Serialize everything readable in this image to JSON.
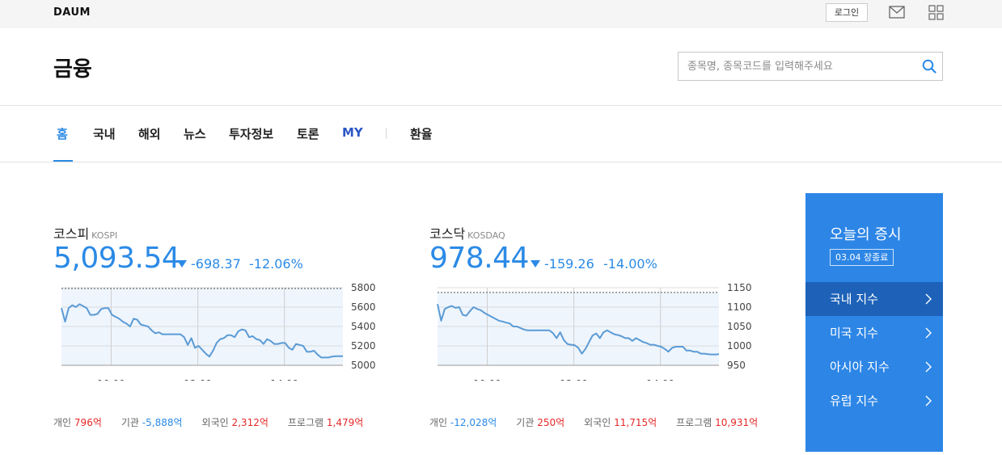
{
  "topbar": {
    "logo": "DAUM",
    "login_label": "로그인"
  },
  "header": {
    "title": "금융",
    "search_placeholder": "종목명, 종목코드를 입력해주세요"
  },
  "nav": {
    "items": [
      {
        "label": "홈"
      },
      {
        "label": "국내"
      },
      {
        "label": "해외"
      },
      {
        "label": "뉴스"
      },
      {
        "label": "투자정보"
      },
      {
        "label": "토론"
      },
      {
        "label": "MY"
      },
      {
        "label": "환율"
      }
    ],
    "active_index": 0
  },
  "markets": [
    {
      "name": "코스피",
      "name_en": "KOSPI",
      "value": "5,093.54",
      "change": "-698.37",
      "change_pct": "-12.06%",
      "trades": [
        {
          "label": "개인",
          "value": "796억",
          "dir": "up"
        },
        {
          "label": "기관",
          "value": "-5,888억",
          "dir": "down"
        },
        {
          "label": "외국인",
          "value": "2,312억",
          "dir": "up"
        },
        {
          "label": "프로그램",
          "value": "1,479억",
          "dir": "up"
        }
      ]
    },
    {
      "name": "코스닥",
      "name_en": "KOSDAQ",
      "value": "978.44",
      "change": "-159.26",
      "change_pct": "-14.00%",
      "trades": [
        {
          "label": "개인",
          "value": "-12,028억",
          "dir": "down"
        },
        {
          "label": "기관",
          "value": "250억",
          "dir": "up"
        },
        {
          "label": "외국인",
          "value": "11,715억",
          "dir": "up"
        },
        {
          "label": "프로그램",
          "value": "10,931억",
          "dir": "up"
        }
      ]
    }
  ],
  "chart_data": [
    {
      "type": "area",
      "x_ticks": [
        "10:00",
        "12:00",
        "14:00"
      ],
      "y_ticks": [
        5800,
        5600,
        5400,
        5200,
        5000
      ],
      "ylim": [
        5000,
        5800
      ],
      "prev_close": 5791.91,
      "x": [
        "09:00",
        "09:05",
        "09:10",
        "09:15",
        "09:20",
        "09:25",
        "09:30",
        "09:35",
        "09:40",
        "09:45",
        "09:50",
        "09:55",
        "10:00",
        "10:05",
        "10:10",
        "10:15",
        "10:20",
        "10:25",
        "10:30",
        "10:35",
        "10:40",
        "10:45",
        "10:50",
        "10:55",
        "11:00",
        "11:05",
        "11:10",
        "11:15",
        "11:20",
        "11:25",
        "11:30",
        "11:35",
        "11:40",
        "11:45",
        "11:50",
        "11:55",
        "12:00",
        "12:05",
        "12:10",
        "12:15",
        "12:20",
        "12:25",
        "12:30",
        "12:35",
        "12:40",
        "12:45",
        "12:50",
        "12:55",
        "13:00",
        "13:05",
        "13:10",
        "13:15",
        "13:20",
        "13:25",
        "13:30",
        "13:35",
        "13:40",
        "13:45",
        "13:50",
        "13:55",
        "14:00",
        "14:05",
        "14:10",
        "14:15",
        "14:20",
        "14:25",
        "14:30",
        "14:35",
        "14:40",
        "14:45",
        "14:50",
        "14:55",
        "15:00",
        "15:05",
        "15:10",
        "15:15",
        "15:20",
        "15:25",
        "15:30"
      ],
      "values": [
        5590,
        5450,
        5590,
        5620,
        5600,
        5630,
        5610,
        5590,
        5520,
        5520,
        5530,
        5580,
        5590,
        5590,
        5520,
        5500,
        5480,
        5450,
        5430,
        5400,
        5480,
        5470,
        5420,
        5410,
        5400,
        5360,
        5330,
        5340,
        5320,
        5320,
        5320,
        5320,
        5320,
        5320,
        5290,
        5210,
        5280,
        5180,
        5200,
        5160,
        5120,
        5090,
        5150,
        5230,
        5270,
        5280,
        5310,
        5310,
        5290,
        5350,
        5370,
        5360,
        5290,
        5300,
        5270,
        5260,
        5220,
        5270,
        5250,
        5220,
        5220,
        5230,
        5230,
        5180,
        5160,
        5220,
        5210,
        5200,
        5140,
        5140,
        5150,
        5110,
        5080,
        5080,
        5080,
        5090,
        5093,
        5093,
        5093.54
      ]
    },
    {
      "type": "area",
      "x_ticks": [
        "10:00",
        "12:00",
        "14:00"
      ],
      "y_ticks": [
        1150,
        1100,
        1050,
        1000,
        950
      ],
      "ylim": [
        950,
        1150
      ],
      "prev_close": 1137.7,
      "x": [
        "09:00",
        "09:05",
        "09:10",
        "09:15",
        "09:20",
        "09:25",
        "09:30",
        "09:35",
        "09:40",
        "09:45",
        "09:50",
        "09:55",
        "10:00",
        "10:05",
        "10:10",
        "10:15",
        "10:20",
        "10:25",
        "10:30",
        "10:35",
        "10:40",
        "10:45",
        "10:50",
        "10:55",
        "11:00",
        "11:05",
        "11:10",
        "11:15",
        "11:20",
        "11:25",
        "11:30",
        "11:35",
        "11:40",
        "11:45",
        "11:50",
        "11:55",
        "12:00",
        "12:05",
        "12:10",
        "12:15",
        "12:20",
        "12:25",
        "12:30",
        "12:35",
        "12:40",
        "12:45",
        "12:50",
        "12:55",
        "13:00",
        "13:05",
        "13:10",
        "13:15",
        "13:20",
        "13:25",
        "13:30",
        "13:35",
        "13:40",
        "13:45",
        "13:50",
        "13:55",
        "14:00",
        "14:05",
        "14:10",
        "14:15",
        "14:20",
        "14:25",
        "14:30",
        "14:35",
        "14:40",
        "14:45",
        "14:50",
        "14:55",
        "15:00",
        "15:05",
        "15:10",
        "15:15",
        "15:20",
        "15:25",
        "15:30"
      ],
      "values": [
        1108,
        1065,
        1095,
        1100,
        1103,
        1098,
        1100,
        1080,
        1078,
        1090,
        1100,
        1095,
        1092,
        1085,
        1080,
        1075,
        1070,
        1065,
        1063,
        1060,
        1058,
        1050,
        1050,
        1046,
        1042,
        1040,
        1040,
        1040,
        1040,
        1040,
        1040,
        1040,
        1033,
        1020,
        1035,
        1015,
        1005,
        1003,
        1002,
        995,
        980,
        992,
        1010,
        1027,
        1032,
        1020,
        1035,
        1040,
        1035,
        1030,
        1028,
        1025,
        1020,
        1020,
        1013,
        1020,
        1015,
        1010,
        1007,
        1003,
        1003,
        1000,
        998,
        992,
        985,
        995,
        998,
        998,
        998,
        988,
        988,
        985,
        985,
        980,
        980,
        978.44,
        978,
        978,
        978.44
      ]
    }
  ],
  "side": {
    "title": "오늘의 증시",
    "date": "03.04 장종료",
    "items": [
      {
        "label": "국내 지수"
      },
      {
        "label": "미국 지수"
      },
      {
        "label": "아시아 지수"
      },
      {
        "label": "유럽 지수"
      }
    ],
    "active_index": 0
  }
}
